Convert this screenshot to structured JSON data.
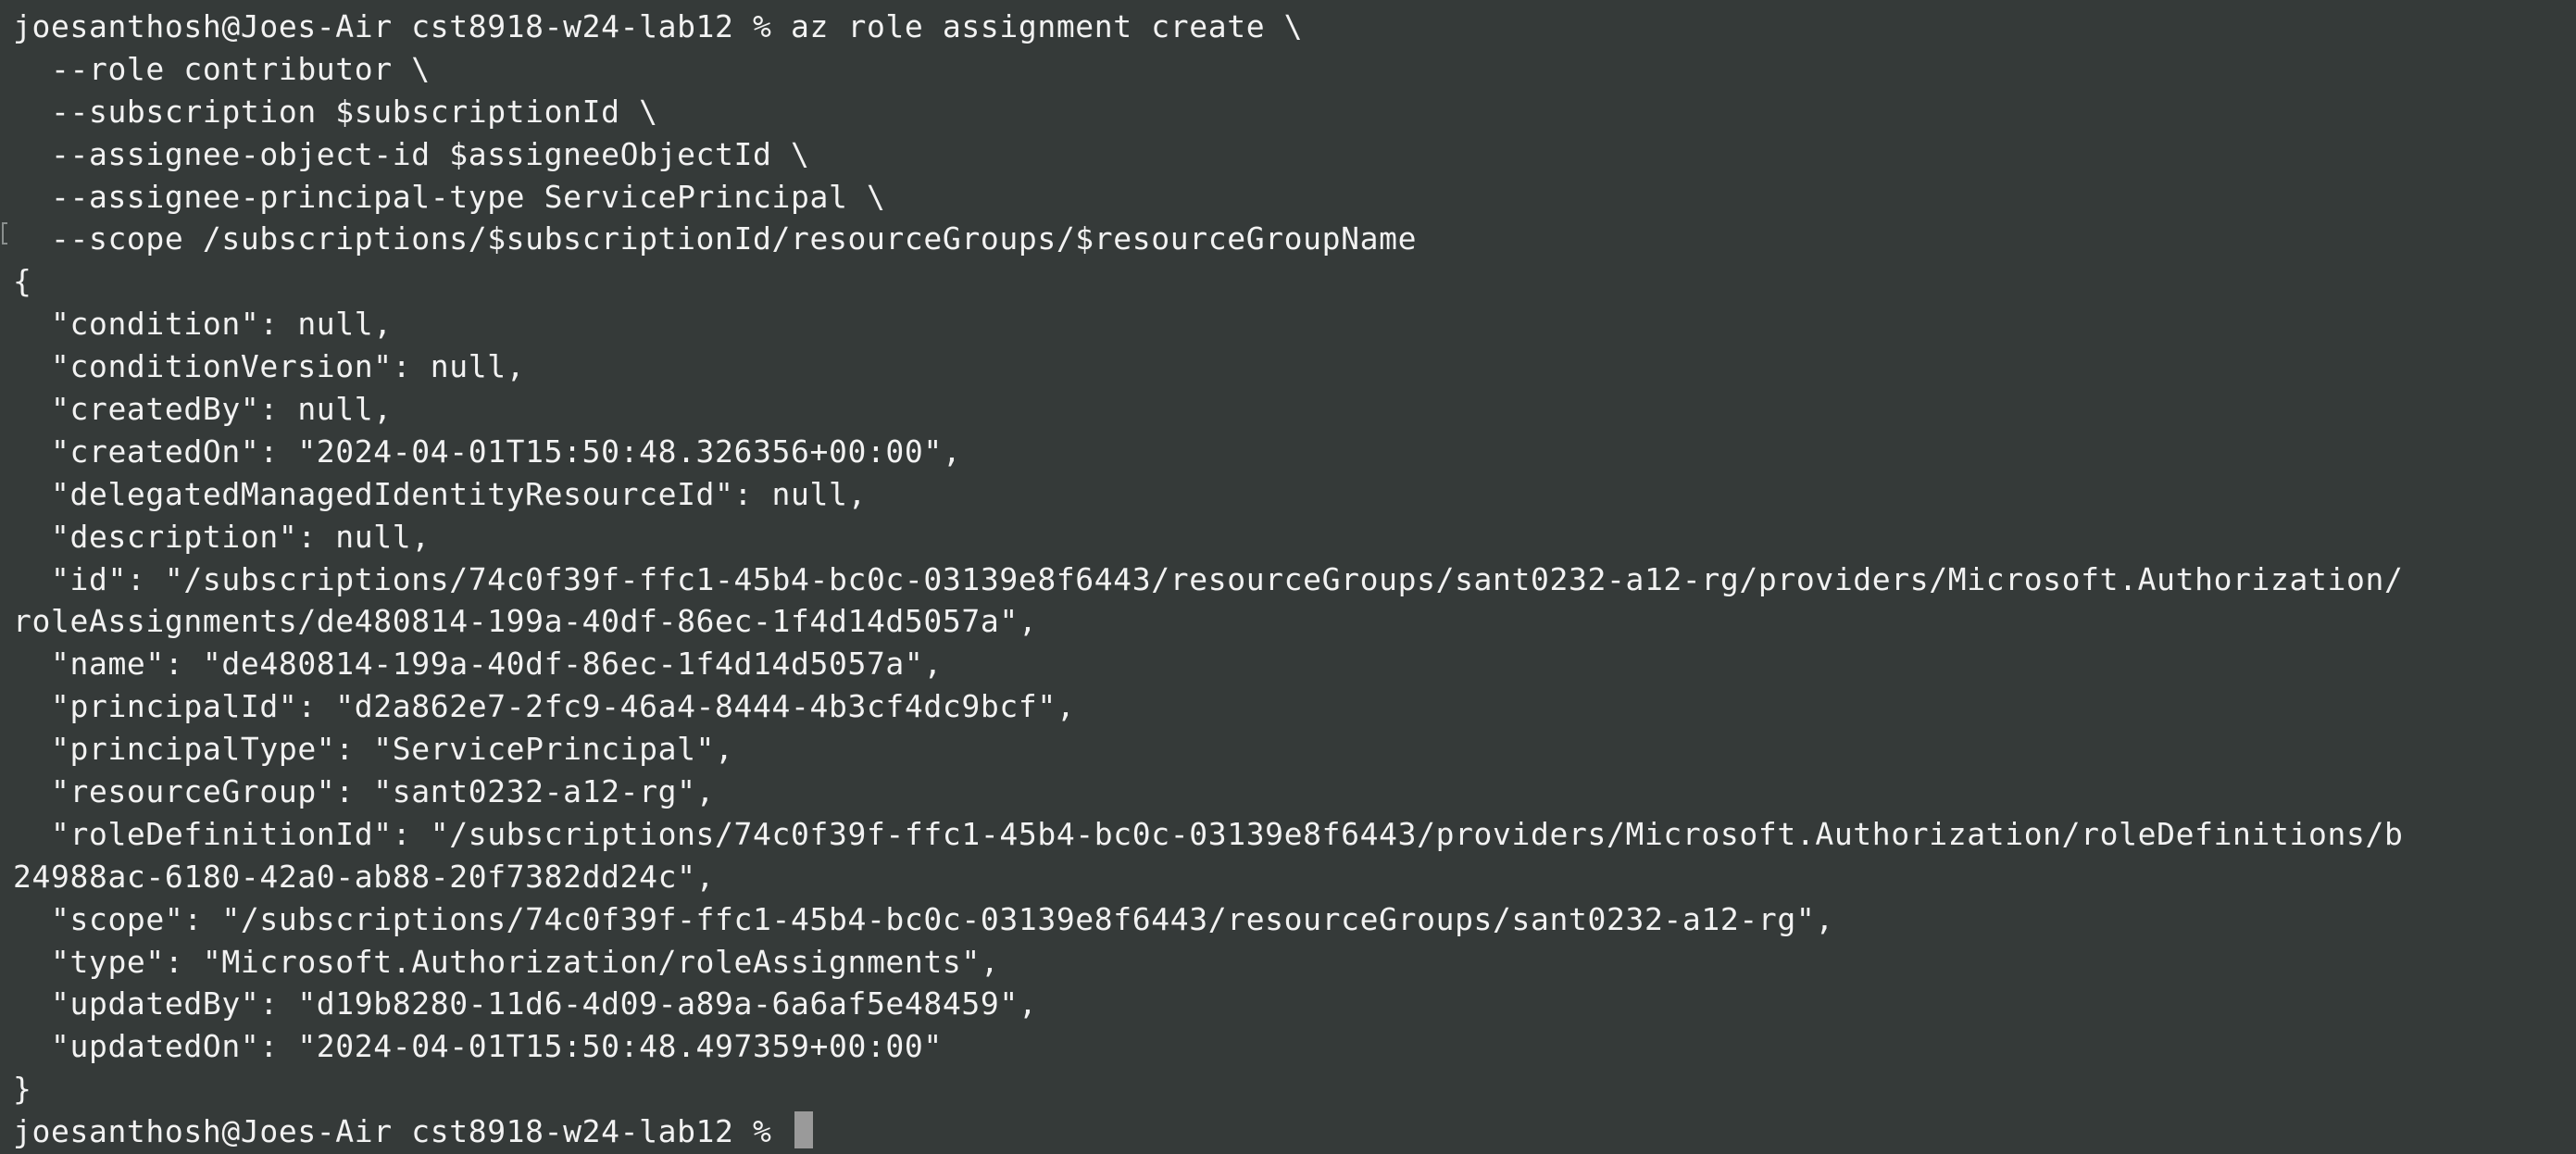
{
  "terminal": {
    "prompt": "joesanthosh@Joes-Air cst8918-w24-lab12 % ",
    "lines": [
      "joesanthosh@Joes-Air cst8918-w24-lab12 % az role assignment create \\",
      "  --role contributor \\",
      "  --subscription $subscriptionId \\",
      "  --assignee-object-id $assigneeObjectId \\",
      "  --assignee-principal-type ServicePrincipal \\",
      "  --scope /subscriptions/$subscriptionId/resourceGroups/$resourceGroupName",
      "{",
      "  \"condition\": null,",
      "  \"conditionVersion\": null,",
      "  \"createdBy\": null,",
      "  \"createdOn\": \"2024-04-01T15:50:48.326356+00:00\",",
      "  \"delegatedManagedIdentityResourceId\": null,",
      "  \"description\": null,",
      "  \"id\": \"/subscriptions/74c0f39f-ffc1-45b4-bc0c-03139e8f6443/resourceGroups/sant0232-a12-rg/providers/Microsoft.Authorization/",
      "roleAssignments/de480814-199a-40df-86ec-1f4d14d5057a\",",
      "  \"name\": \"de480814-199a-40df-86ec-1f4d14d5057a\",",
      "  \"principalId\": \"d2a862e7-2fc9-46a4-8444-4b3cf4dc9bcf\",",
      "  \"principalType\": \"ServicePrincipal\",",
      "  \"resourceGroup\": \"sant0232-a12-rg\",",
      "  \"roleDefinitionId\": \"/subscriptions/74c0f39f-ffc1-45b4-bc0c-03139e8f6443/providers/Microsoft.Authorization/roleDefinitions/b",
      "24988ac-6180-42a0-ab88-20f7382dd24c\",",
      "  \"scope\": \"/subscriptions/74c0f39f-ffc1-45b4-bc0c-03139e8f6443/resourceGroups/sant0232-a12-rg\",",
      "  \"type\": \"Microsoft.Authorization/roleAssignments\",",
      "  \"updatedBy\": \"d19b8280-11d6-4d09-a89a-6a6af5e48459\",",
      "  \"updatedOn\": \"2024-04-01T15:50:48.497359+00:00\"",
      "}"
    ]
  },
  "colors": {
    "background": "#353a39",
    "text": "#f2f2f2",
    "cursor": "#9a9a9a"
  }
}
